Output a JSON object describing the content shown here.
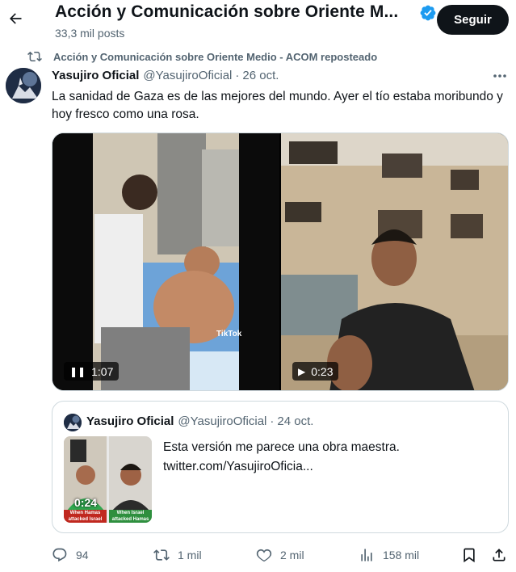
{
  "header": {
    "title": "Acción y Comunicación sobre Oriente M...",
    "post_count": "33,3 mil posts",
    "follow_label": "Seguir"
  },
  "repost": {
    "text": "Acción y Comunicación sobre Oriente Medio - ACOM reposteado"
  },
  "post": {
    "author_name": "Yasujiro Oficial",
    "handle": "@YasujiroOficial",
    "separator": "·",
    "date": "26 oct.",
    "text": "La sanidad de Gaza es de las mejores del mundo. Ayer el tío estaba moribundo y hoy fresco como una rosa.",
    "media": [
      {
        "state_icon": "pause-icon",
        "duration": "1:07",
        "overlay_text": "TikTok"
      },
      {
        "state_icon": "play-icon",
        "duration": "0:23"
      }
    ]
  },
  "quote": {
    "author_name": "Yasujiro Oficial",
    "handle": "@YasujiroOficial",
    "separator": "·",
    "date": "24 oct.",
    "line1": "Esta versión me parece una obra maestra.",
    "line2": "twitter.com/YasujiroOficia...",
    "thumb_duration": "0:24",
    "thumb_caption_left": "When Hamas attacked Israel",
    "thumb_caption_right": "When Israel attacked Hamas"
  },
  "actions": {
    "replies": "94",
    "reposts": "1 mil",
    "likes": "2 mil",
    "views": "158 mil"
  },
  "colors": {
    "text": "#0f1419",
    "secondary": "#536471",
    "verified": "#1d9bf0",
    "border": "#cfd9de"
  }
}
